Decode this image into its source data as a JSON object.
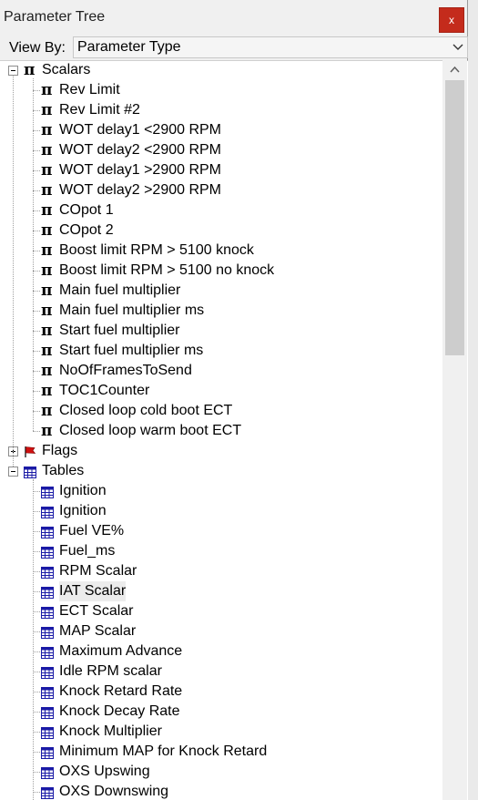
{
  "window": {
    "title": "Parameter Tree",
    "close_label": "x"
  },
  "view_by": {
    "label": "View By:",
    "value": "Parameter Type"
  },
  "tree": {
    "scalars": {
      "label": "Scalars",
      "items": [
        "Rev Limit",
        "Rev Limit #2",
        "WOT delay1  <2900 RPM",
        "WOT delay2  <2900 RPM",
        "WOT delay1  >2900 RPM",
        "WOT delay2  >2900 RPM",
        "COpot 1",
        "COpot 2",
        "Boost limit RPM > 5100 knock",
        "Boost limit RPM > 5100 no knock",
        "Main fuel multiplier",
        "Main fuel multiplier ms",
        "Start fuel multiplier",
        "Start fuel multiplier ms",
        "NoOfFramesToSend",
        "TOC1Counter",
        "Closed loop cold boot ECT",
        "Closed loop warm boot ECT"
      ]
    },
    "flags": {
      "label": "Flags"
    },
    "tables": {
      "label": "Tables",
      "items": [
        "Ignition",
        "Ignition",
        "Fuel VE%",
        "Fuel_ms",
        "RPM Scalar",
        "IAT Scalar",
        "ECT Scalar",
        "MAP Scalar",
        "Maximum Advance",
        "Idle RPM scalar",
        "Knock Retard Rate",
        "Knock Decay Rate",
        "Knock Multiplier",
        "Minimum MAP for Knock Retard",
        "OXS Upswing",
        "OXS Downswing"
      ],
      "selected_item": "IAT Scalar"
    }
  },
  "icons": {
    "scalar": "pi-icon",
    "flag": "flag-icon",
    "table": "table-grid-icon"
  },
  "colors": {
    "close_button": "#c42b1c",
    "table_icon": "#1a1aa6",
    "flag_icon": "#d01010"
  }
}
